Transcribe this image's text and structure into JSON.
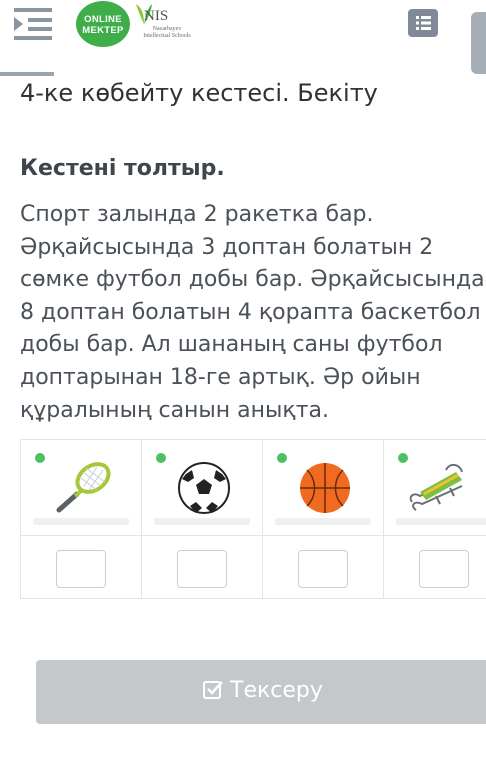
{
  "header": {
    "logo_onlinemektep_line1": "ONLINE",
    "logo_onlinemektep_line2": "MEKTEP",
    "logo_nis": "NIS",
    "logo_nis_subtitle": "Nazarbayev Intellectual Schools"
  },
  "lesson": {
    "title": "4-ке көбейту кестесі. Бекіту"
  },
  "task": {
    "heading": "Кестені толтыр.",
    "text_lines": [
      "Спорт залында 2 ракетка бар.",
      "Әрқайсысында 3 доптан болатын 2",
      "сөмке футбол добы бар. Әрқайсысында",
      "8 доптан болатын 4 қорапта баскетбол",
      "добы бар. Ал шананың саны футбол",
      "доптарынан 18-ге артық. Әр ойын",
      "құралының санын анықта."
    ]
  },
  "table": {
    "items": [
      {
        "icon": "tennis-racket-icon",
        "answer": ""
      },
      {
        "icon": "soccer-ball-icon",
        "answer": ""
      },
      {
        "icon": "basketball-icon",
        "answer": ""
      },
      {
        "icon": "sled-icon",
        "answer": ""
      }
    ]
  },
  "check_button": {
    "label": "Тексеру",
    "icon": "checkbox-icon"
  },
  "colors": {
    "brand_green": "#3fae49",
    "button_disabled": "#c5c8cb",
    "header_gray": "#7f8a96"
  }
}
